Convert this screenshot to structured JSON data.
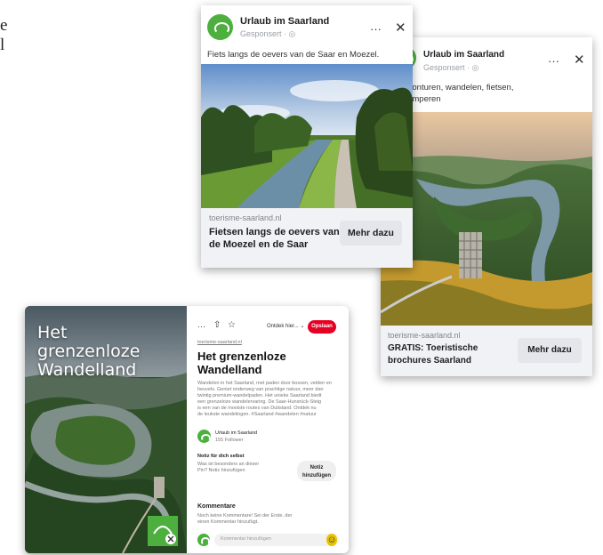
{
  "corner_text": [
    "e",
    "l"
  ],
  "ad_left": {
    "advertiser": "Urlaub im Saarland",
    "sponsored": "Gesponsert · ◎",
    "caption": "Fiets langs de oevers van de Saar en Moezel.",
    "domain": "toerisme-saarland.nl",
    "headline_lines": [
      "Fietsen langs de oevers van",
      "de Moezel en de Saar"
    ],
    "cta": "Mehr dazu",
    "more_glyph": "···",
    "close_glyph": "✕"
  },
  "ad_right": {
    "advertiser": "Urlaub im Saarland",
    "sponsored": "Gesponsert · ◎",
    "caption_lines": [
      "nloze avonturen, wandelen, fietsen,",
      "nloos kamperen"
    ],
    "domain": "toerisme-saarland.nl",
    "headline_lines": [
      "GRATIS: Toeristische",
      "brochures Saarland"
    ],
    "cta": "Mehr dazu",
    "more_glyph": "···",
    "close_glyph": "✕"
  },
  "pin": {
    "overlay_title_lines": [
      "Het",
      "grenzenloze",
      "Wandelland"
    ],
    "toolbar_more": "···",
    "toolbar_share": "⇧",
    "toolbar_star": "☆",
    "board_select": "Ontdek hier... ⌄",
    "save_label": "Opslaan",
    "source_link": "toerisme-saarland.nl",
    "title_lines": [
      "Het grenzenloze",
      "Wandelland"
    ],
    "description_lines": [
      "Wandelen in het Saarland, met paden door bossen, velden en",
      "heuvels. Geniet onderweg van prachtige natuur, meer dan",
      "twintig premium-wandelpaden. Het unieke Saarland biedt",
      "een grenzeloze wandelervaring. De Saar-Hunsrück-Steig",
      "is een van de mooiste routes van Duitsland. Ontdek nu",
      "de leukste wandelingen. #Saarland #wandelen #natuur"
    ],
    "author_name": "Urlaub im Saarland",
    "author_followers": "155 Follower",
    "note_title": "Notiz für dich selbst",
    "note_text_lines": [
      "Was ist besonders an dieser",
      "Pin? Notiz hinzufügen"
    ],
    "note_button_lines": [
      "Notiz",
      "hinzufügen"
    ],
    "comments_title": "Kommentare",
    "comments_text_lines": [
      "Noch keine Kommentare! Sei der Erste, der",
      "einen Kommentar hinzufügt."
    ],
    "comment_placeholder": "Kommentar hinzufügen",
    "emoji_icon": "☺"
  }
}
